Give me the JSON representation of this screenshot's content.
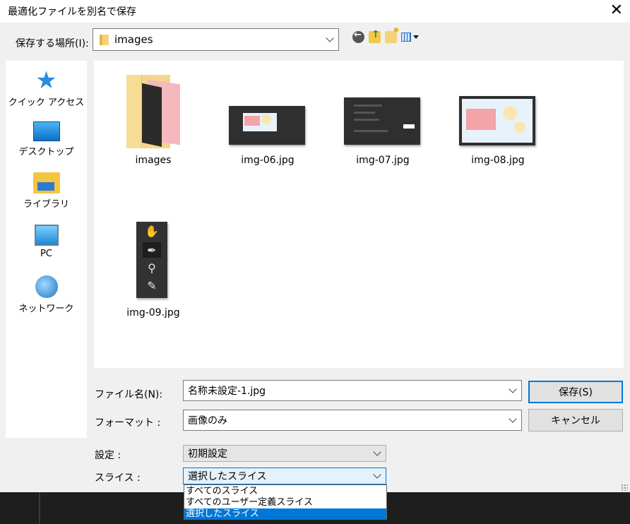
{
  "window": {
    "title": "最適化ファイルを別名で保存",
    "close_glyph": "✕"
  },
  "location": {
    "label": "保存する場所(I):",
    "value": "images"
  },
  "toolbar": {
    "icons": [
      "back-icon",
      "up-folder-icon",
      "new-folder-icon",
      "view-menu-icon"
    ]
  },
  "places": [
    {
      "label": "クイック アクセス",
      "icon": "star-icon"
    },
    {
      "label": "デスクトップ",
      "icon": "desktop-icon"
    },
    {
      "label": "ライブラリ",
      "icon": "library-icon"
    },
    {
      "label": "PC",
      "icon": "pc-icon"
    },
    {
      "label": "ネットワーク",
      "icon": "network-icon"
    }
  ],
  "files": [
    {
      "name": "images",
      "kind": "folder"
    },
    {
      "name": "img-06.jpg",
      "kind": "image"
    },
    {
      "name": "img-07.jpg",
      "kind": "image"
    },
    {
      "name": "img-08.jpg",
      "kind": "image"
    },
    {
      "name": "img-09.jpg",
      "kind": "image"
    }
  ],
  "form": {
    "filename_label": "ファイル名(N):",
    "filename_value": "名称未設定-1.jpg",
    "format_label": "フォーマット :",
    "format_value": "画像のみ",
    "settings_label": "設定 :",
    "settings_value": "初期設定",
    "slice_label": "スライス :",
    "slice_value": "選択したスライス"
  },
  "buttons": {
    "save": "保存(S)",
    "cancel": "キャンセル"
  },
  "slice_options": [
    "すべてのスライス",
    "すべてのユーザー定義スライス",
    "選択したスライス"
  ],
  "slice_selected_index": 2,
  "colors": {
    "accent": "#0078d7",
    "dialog_bg": "#f0f0f0",
    "pane_bg": "#ffffff",
    "app_bg": "#1e1e1e"
  }
}
